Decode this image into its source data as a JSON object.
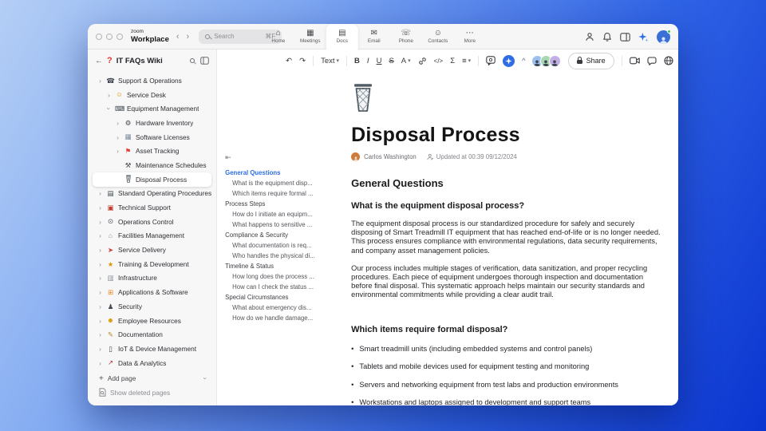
{
  "titlebar": {
    "brand_top": "zoom",
    "brand_bottom": "Workplace",
    "back": "‹",
    "forward": "›",
    "search_placeholder": "Search",
    "search_shortcut": "⌘F",
    "tabs": [
      {
        "label": "Home",
        "glyph": "⌂"
      },
      {
        "label": "Meetings",
        "glyph": "▦"
      },
      {
        "label": "Docs",
        "glyph": "▤",
        "active": true
      },
      {
        "label": "Email",
        "glyph": "✉"
      },
      {
        "label": "Phone",
        "glyph": "☏"
      },
      {
        "label": "Contacts",
        "glyph": "☺"
      },
      {
        "label": "More",
        "glyph": "⋯"
      }
    ]
  },
  "sidebar": {
    "back_arrow": "←",
    "wiki_icon": "?",
    "title": "IT FAQs Wiki",
    "items": [
      {
        "label": "Support & Operations",
        "level": 0,
        "chev": "right",
        "icon": "☎",
        "color": "#3f4850"
      },
      {
        "label": "Service Desk",
        "level": 1,
        "chev": "right",
        "icon": "☺",
        "color": "#d99a00"
      },
      {
        "label": "Equipment Management",
        "level": 1,
        "chev": "down",
        "icon": "⌨",
        "color": "#3f4850"
      },
      {
        "label": "Hardware Inventory",
        "level": 2,
        "chev": "right",
        "icon": "⚙",
        "color": "#3f4850"
      },
      {
        "label": "Software Licenses",
        "level": 2,
        "chev": "right",
        "icon": "▦",
        "color": "#7a8ba0"
      },
      {
        "label": "Asset Tracking",
        "level": 2,
        "chev": "right",
        "icon": "⚑",
        "color": "#e03c31"
      },
      {
        "label": "Maintenance Schedules",
        "level": 2,
        "chev": "",
        "icon": "⚒",
        "color": "#3f4850"
      },
      {
        "label": "Disposal Process",
        "level": 2,
        "chev": "",
        "svg": "trash",
        "selected": true
      },
      {
        "label": "Standard Operating Procedures",
        "level": 0,
        "chev": "right",
        "icon": "▤",
        "color": "#3f4850"
      },
      {
        "label": "Technical Support",
        "level": 0,
        "chev": "right",
        "icon": "▣",
        "color": "#c0392b"
      },
      {
        "label": "Operations Control",
        "level": 0,
        "chev": "right",
        "icon": "⊙",
        "color": "#3f4850"
      },
      {
        "label": "Facilities Management",
        "level": 0,
        "chev": "right",
        "icon": "⌂",
        "color": "#8a9099"
      },
      {
        "label": "Service Delivery",
        "level": 0,
        "chev": "right",
        "icon": "➤",
        "color": "#d23f31"
      },
      {
        "label": "Training & Development",
        "level": 0,
        "chev": "right",
        "icon": "★",
        "color": "#d99a00"
      },
      {
        "label": "Infrastructure",
        "level": 0,
        "chev": "right",
        "icon": "▥",
        "color": "#8a9099"
      },
      {
        "label": "Applications & Software",
        "level": 0,
        "chev": "right",
        "icon": "⊞",
        "color": "#e8872a"
      },
      {
        "label": "Security",
        "level": 0,
        "chev": "right",
        "icon": "♟",
        "color": "#3f4850"
      },
      {
        "label": "Employee Resources",
        "level": 0,
        "chev": "right",
        "icon": "☻",
        "color": "#d99a00"
      },
      {
        "label": "Documentation",
        "level": 0,
        "chev": "right",
        "icon": "✎",
        "color": "#b58a2a"
      },
      {
        "label": "IoT & Device Management",
        "level": 0,
        "chev": "right",
        "icon": "▯",
        "color": "#3f4850"
      },
      {
        "label": "Data & Analytics",
        "level": 0,
        "chev": "right",
        "icon": "↗",
        "color": "#c0392b"
      }
    ],
    "footer": {
      "plus": "+",
      "add_page": "Add page",
      "show_deleted": "Show deleted pages"
    }
  },
  "toolbar": {
    "undo": "↶",
    "redo": "↷",
    "text_style": "Text",
    "caret": "▾",
    "bold": "B",
    "italic": "I",
    "underline": "U",
    "strike": "S",
    "color": "A",
    "code": "</>",
    "equation": "Σ",
    "list": "≡",
    "collapse": "^",
    "share_label": "Share",
    "more": "⋯"
  },
  "collaborators": [
    {
      "color": "#9cc0ee"
    },
    {
      "color": "#a8d8b0"
    },
    {
      "color": "#c3aee6"
    }
  ],
  "toc": {
    "collapse_icon": "⇤",
    "items": [
      {
        "t": "sec",
        "label": "General Questions",
        "active": true
      },
      {
        "t": "sub",
        "label": "What is the equipment disp..."
      },
      {
        "t": "sub",
        "label": "Which items require formal ..."
      },
      {
        "t": "sec",
        "label": "Process Steps"
      },
      {
        "t": "sub",
        "label": "How do I initiate an equipm..."
      },
      {
        "t": "sub",
        "label": "What happens to sensitive ..."
      },
      {
        "t": "sec",
        "label": "Compliance & Security"
      },
      {
        "t": "sub",
        "label": "What documentation is req..."
      },
      {
        "t": "sub",
        "label": "Who handles the physical di..."
      },
      {
        "t": "sec",
        "label": "Timeline & Status"
      },
      {
        "t": "sub",
        "label": "How long does the process ..."
      },
      {
        "t": "sub",
        "label": "How can I check the status ..."
      },
      {
        "t": "sec",
        "label": "Special Circumstances"
      },
      {
        "t": "sub",
        "label": "What about emergency dis..."
      },
      {
        "t": "sub",
        "label": "How do we handle damage..."
      }
    ]
  },
  "doc": {
    "title": "Disposal Process",
    "author": "Carlos Washington",
    "updated": "Updated at 00:39 09/12/2024",
    "h2": "General Questions",
    "q1": "What is the equipment disposal process?",
    "p1": "The equipment disposal process is our standardized procedure for safely and securely disposing of Smart Treadmill IT equipment that has reached end-of-life or is no longer needed. This process ensures compliance with environmental regulations, data security requirements, and company asset management policies.",
    "p2": "Our process includes multiple stages of verification, data sanitization, and proper recycling procedures. Each piece of equipment undergoes thorough inspection and documentation before final disposal. This systematic approach helps maintain our security standards and environmental commitments while providing a clear audit trail.",
    "q2": "Which items require formal disposal?",
    "bullets": [
      {
        "label": "Smart treadmill units (including embedded systems and control panels)"
      },
      {
        "label": "Tablets and mobile devices used for equipment testing and monitoring"
      },
      {
        "label": "Servers and networking equipment from test labs and production environments"
      },
      {
        "label": "Workstations and laptops assigned to development and support teams"
      }
    ]
  },
  "colors": {
    "accent": "#2e6de5",
    "status_green": "#34c759",
    "pin_red": "#e03c31"
  }
}
